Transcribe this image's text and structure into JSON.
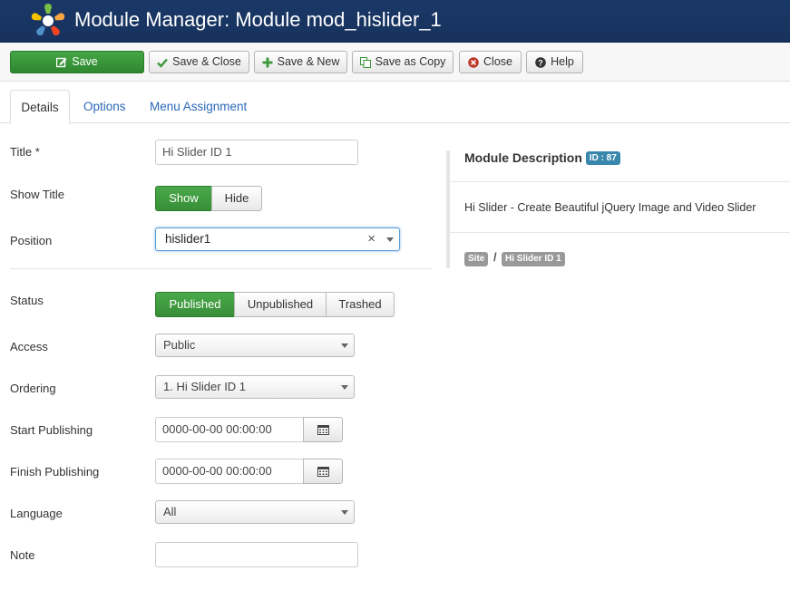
{
  "header": {
    "title": "Module Manager: Module mod_hislider_1",
    "logo_icon": "joomla-logo-icon"
  },
  "toolbar": {
    "save": "Save",
    "save_close": "Save & Close",
    "save_new": "Save & New",
    "save_copy": "Save as Copy",
    "close": "Close",
    "help": "Help"
  },
  "tabs": [
    {
      "label": "Details",
      "active": true
    },
    {
      "label": "Options",
      "active": false
    },
    {
      "label": "Menu Assignment",
      "active": false
    }
  ],
  "form": {
    "title": {
      "label": "Title *",
      "value": "Hi Slider ID 1"
    },
    "show_title": {
      "label": "Show Title",
      "options": [
        "Show",
        "Hide"
      ],
      "selected": "Show"
    },
    "position": {
      "label": "Position",
      "value": "hislider1",
      "clear_symbol": "×"
    },
    "status": {
      "label": "Status",
      "options": [
        "Published",
        "Unpublished",
        "Trashed"
      ],
      "selected": "Published"
    },
    "access": {
      "label": "Access",
      "value": "Public"
    },
    "ordering": {
      "label": "Ordering",
      "value": "1. Hi Slider ID 1"
    },
    "start_publishing": {
      "label": "Start Publishing",
      "value": "0000-00-00 00:00:00"
    },
    "finish_publishing": {
      "label": "Finish Publishing",
      "value": "0000-00-00 00:00:00"
    },
    "language": {
      "label": "Language",
      "value": "All"
    },
    "note": {
      "label": "Note",
      "value": ""
    }
  },
  "sidebar": {
    "heading": "Module Description",
    "id_badge": "ID : 87",
    "description": "Hi Slider - Create Beautiful jQuery Image and Video Slider",
    "breadcrumb": [
      "Site",
      "Hi Slider ID 1"
    ],
    "breadcrumb_separator": "/"
  },
  "colors": {
    "header_bg": "#1a3867",
    "save_green": "#3a963a",
    "active_toggle": "#46a546",
    "badge_blue": "#3a87ad",
    "link_blue": "#2a69b8"
  }
}
